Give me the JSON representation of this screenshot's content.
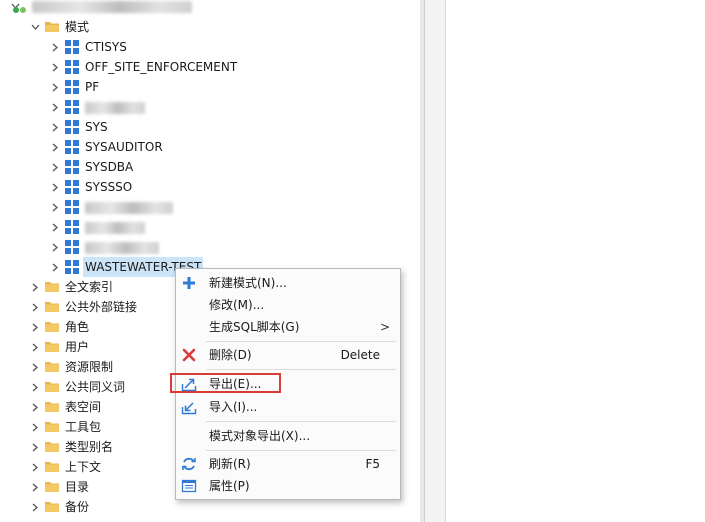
{
  "tree": {
    "connection_label": "",
    "schema_group_label": "模式",
    "schemas": [
      {
        "label": "CTISYS",
        "blurred": false
      },
      {
        "label": "OFF_SITE_ENFORCEMENT",
        "blurred": false
      },
      {
        "label": "PF",
        "blurred": false
      },
      {
        "label": "",
        "blurred": true
      },
      {
        "label": "SYS",
        "blurred": false
      },
      {
        "label": "SYSAUDITOR",
        "blurred": false
      },
      {
        "label": "SYSDBA",
        "blurred": false
      },
      {
        "label": "SYSSSO",
        "blurred": false
      },
      {
        "label": "",
        "blurred": true
      },
      {
        "label": "",
        "blurred": true
      },
      {
        "label": "",
        "blurred": true
      },
      {
        "label": "WASTEWATER-TEST",
        "blurred": false,
        "selected": true
      }
    ],
    "folders": [
      "全文索引",
      "公共外部链接",
      "角色",
      "用户",
      "资源限制",
      "公共同义词",
      "表空间",
      "工具包",
      "类型别名",
      "上下文",
      "目录",
      "备份"
    ]
  },
  "context_menu": {
    "items": [
      {
        "label": "新建模式(N)...",
        "icon": "plus-icon"
      },
      {
        "label": "修改(M)...",
        "icon": ""
      },
      {
        "label": "生成SQL脚本(G)",
        "icon": "",
        "submenu": true,
        "arrow": ">"
      },
      {
        "label": "删除(D)",
        "icon": "delete-x-icon",
        "shortcut": "Delete"
      },
      {
        "label": "导出(E)...",
        "icon": "export-icon",
        "highlighted": true
      },
      {
        "label": "导入(I)...",
        "icon": "import-icon"
      },
      {
        "label": "模式对象导出(X)...",
        "icon": ""
      },
      {
        "label": "刷新(R)",
        "icon": "refresh-icon",
        "shortcut": "F5"
      },
      {
        "label": "属性(P)",
        "icon": "properties-icon"
      }
    ]
  },
  "colors": {
    "folder": "#e8b64a",
    "schema_icon": "#2f7ad6",
    "selection": "#cce4f7",
    "highlight_box": "#d93a3a",
    "delete_red": "#d93a3a",
    "accent_blue": "#2f7ad6"
  }
}
